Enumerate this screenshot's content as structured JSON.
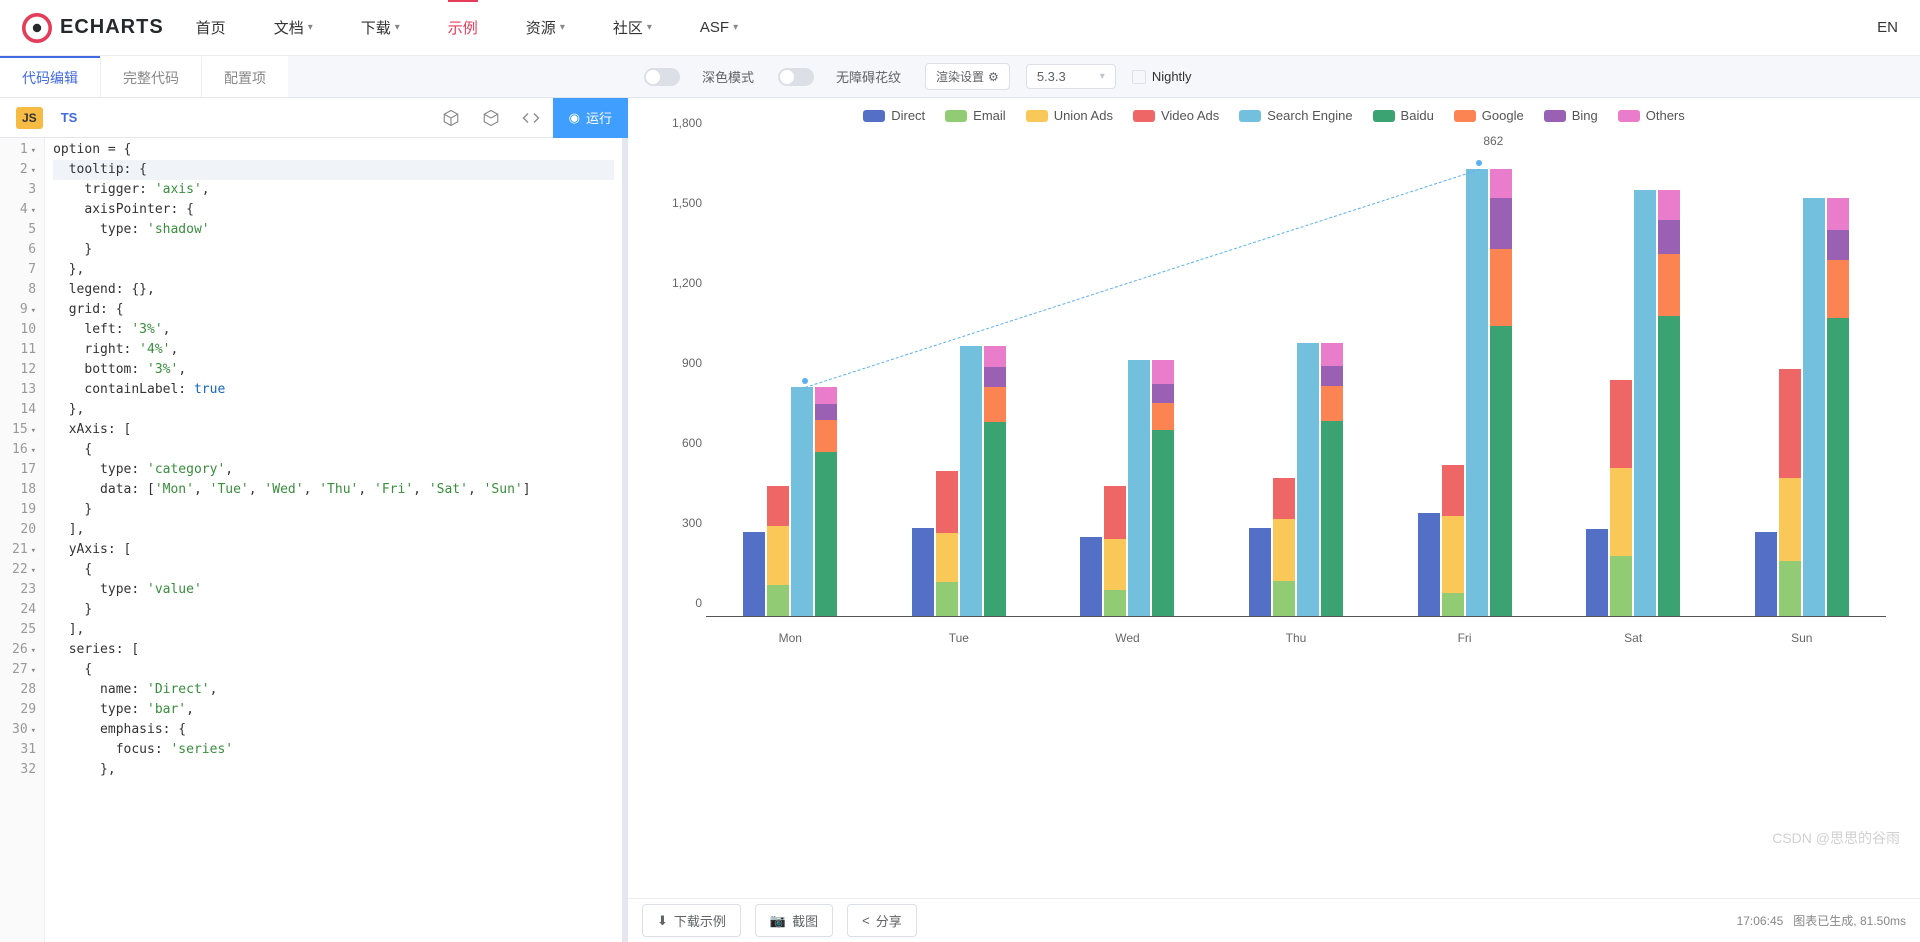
{
  "header": {
    "brand": "ECHARTS",
    "nav": [
      "首页",
      "文档",
      "下载",
      "示例",
      "资源",
      "社区",
      "ASF"
    ],
    "nav_has_caret": [
      false,
      true,
      true,
      false,
      true,
      true,
      true
    ],
    "active": "示例",
    "lang": "EN"
  },
  "toolbar": {
    "tabs": [
      "代码编辑",
      "完整代码",
      "配置项"
    ],
    "active_tab": "代码编辑",
    "dark_mode": "深色模式",
    "a11y_pattern": "无障碍花纹",
    "render_settings": "渲染设置",
    "version": "5.3.3",
    "nightly": "Nightly"
  },
  "subtoolbar": {
    "js": "JS",
    "ts": "TS",
    "run": "运行"
  },
  "code_lines": [
    "option = {",
    "  tooltip: {",
    "    trigger: 'axis',",
    "    axisPointer: {",
    "      type: 'shadow'",
    "    }",
    "  },",
    "  legend: {},",
    "  grid: {",
    "    left: '3%',",
    "    right: '4%',",
    "    bottom: '3%',",
    "    containLabel: true",
    "  },",
    "  xAxis: [",
    "    {",
    "      type: 'category',",
    "      data: ['Mon', 'Tue', 'Wed', 'Thu', 'Fri', 'Sat', 'Sun']",
    "    }",
    "  ],",
    "  yAxis: [",
    "    {",
    "      type: 'value'",
    "    }",
    "  ],",
    "  series: [",
    "    {",
    "      name: 'Direct',",
    "      type: 'bar',",
    "      emphasis: {",
    "        focus: 'series'",
    "      },"
  ],
  "fold_lines": [
    1,
    2,
    4,
    9,
    15,
    16,
    21,
    22,
    26,
    27,
    30
  ],
  "bottom": {
    "download": "下载示例",
    "screenshot": "截图",
    "share": "分享",
    "time": "17:06:45",
    "status": "图表已生成, 81.50ms"
  },
  "watermark": "CSDN @思思的谷雨",
  "chart_data": {
    "type": "bar",
    "categories": [
      "Mon",
      "Tue",
      "Wed",
      "Thu",
      "Fri",
      "Sat",
      "Sun"
    ],
    "ylim": [
      0,
      1800
    ],
    "y_ticks": [
      0,
      300,
      600,
      900,
      1200,
      1500,
      1800
    ],
    "label_value": 862,
    "color_map": {
      "Direct": "#5470c6",
      "Email": "#91cc75",
      "Union Ads": "#fac858",
      "Video Ads": "#ee6666",
      "Search Engine": "#73c0de",
      "Baidu": "#3ba272",
      "Google": "#fc8452",
      "Bing": "#9a60b4",
      "Others": "#ea7ccc"
    },
    "legend": [
      "Direct",
      "Email",
      "Union Ads",
      "Video Ads",
      "Search Engine",
      "Baidu",
      "Google",
      "Bing",
      "Others"
    ],
    "bars": {
      "Direct": {
        "stack": "a",
        "values": [
          320,
          332,
          301,
          334,
          390,
          330,
          320
        ]
      },
      "Email": {
        "stack": "b",
        "values": [
          120,
          132,
          101,
          134,
          90,
          230,
          210
        ]
      },
      "Union Ads": {
        "stack": "b",
        "values": [
          220,
          182,
          191,
          234,
          290,
          330,
          310
        ]
      },
      "Video Ads": {
        "stack": "b",
        "values": [
          150,
          232,
          201,
          154,
          190,
          330,
          410
        ]
      },
      "Search Engine": {
        "stack": "c",
        "values": [
          862,
          1018,
          964,
          1026,
          1679,
          1600,
          1570
        ]
      },
      "Baidu": {
        "stack": "d",
        "values": [
          620,
          732,
          701,
          734,
          1090,
          1130,
          1120
        ]
      },
      "Google": {
        "stack": "d",
        "values": [
          120,
          132,
          101,
          134,
          290,
          230,
          220
        ]
      },
      "Bing": {
        "stack": "d",
        "values": [
          60,
          72,
          71,
          74,
          190,
          130,
          110
        ]
      },
      "Others": {
        "stack": "d",
        "values": [
          62,
          82,
          91,
          84,
          109,
          110,
          120
        ]
      }
    }
  }
}
